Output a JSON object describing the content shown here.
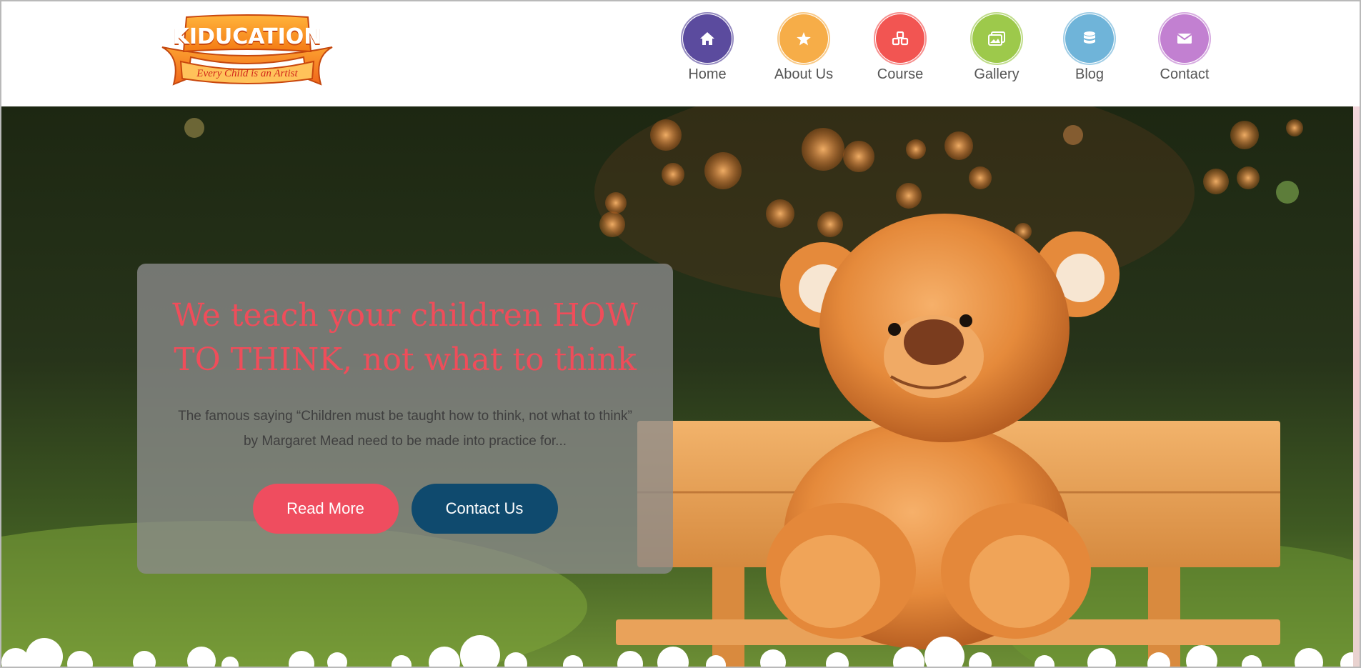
{
  "brand": {
    "name": "KIDUCATION",
    "tagline": "Every Child is an Artist"
  },
  "nav": [
    {
      "label": "Home",
      "icon": "home-icon",
      "color": "#5b4b9e"
    },
    {
      "label": "About Us",
      "icon": "star-icon",
      "color": "#f6ad48"
    },
    {
      "label": "Course",
      "icon": "cubes-icon",
      "color": "#f25552"
    },
    {
      "label": "Gallery",
      "icon": "image-icon",
      "color": "#9dc94b"
    },
    {
      "label": "Blog",
      "icon": "database-icon",
      "color": "#6fb4d9"
    },
    {
      "label": "Contact",
      "icon": "envelope-icon",
      "color": "#c280d1"
    }
  ],
  "hero": {
    "title": "We teach your children HOW TO THINK, not what to think",
    "text": "The famous saying “Children must be taught how to think, not what to think” by Margaret Mead need to be made into practice for...",
    "read_more": "Read More",
    "contact_us": "Contact Us"
  },
  "colors": {
    "accent_red": "#ef4d5f",
    "accent_navy": "#0f4a6e"
  }
}
